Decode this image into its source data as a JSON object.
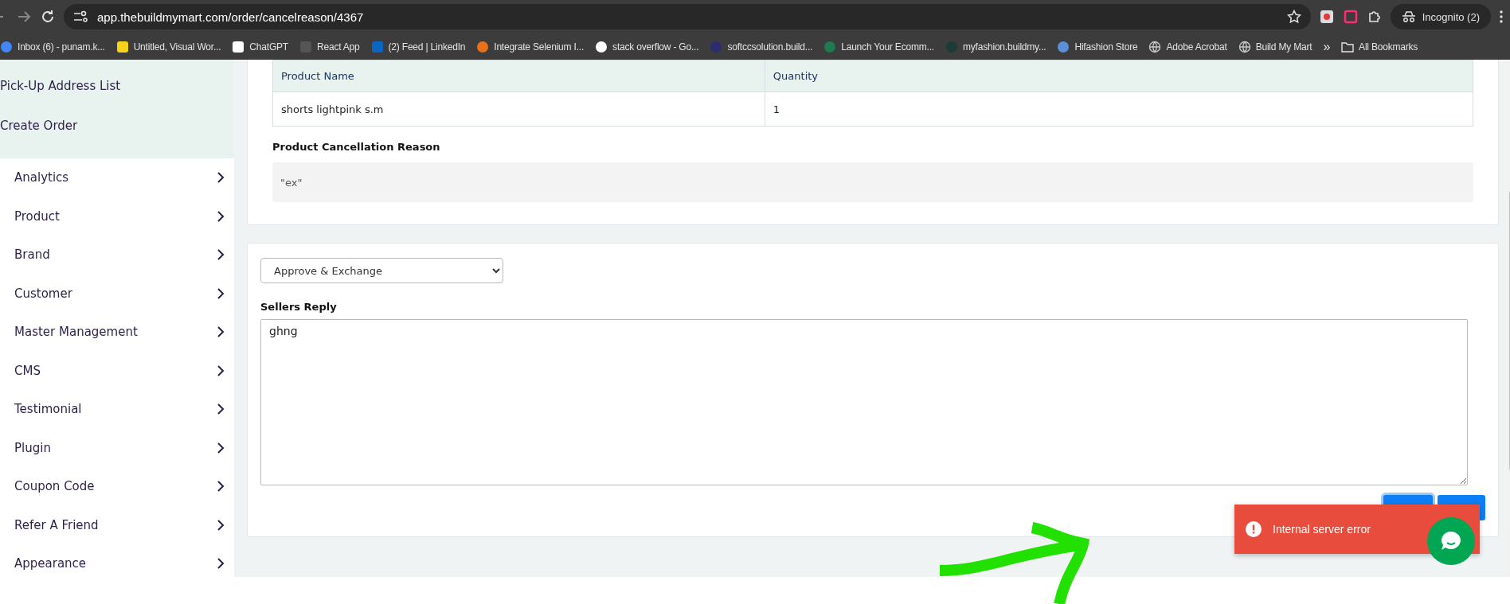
{
  "browser": {
    "url": "app.thebuildmymart.com/order/cancelreason/4367",
    "incognito_label": "Incognito (2)",
    "bookmarks": [
      {
        "label": "Inbox (6) - punam.k...",
        "kind": "circle",
        "color": "#4285f4"
      },
      {
        "label": "Untitled, Visual Wor...",
        "kind": "square",
        "color": "#f7d21a"
      },
      {
        "label": "ChatGPT",
        "kind": "square",
        "color": "#ffffff"
      },
      {
        "label": "React App",
        "kind": "square",
        "color": "#555555"
      },
      {
        "label": "(2) Feed | LinkedIn",
        "kind": "square",
        "color": "#0a66c2"
      },
      {
        "label": "Integrate Selenium I...",
        "kind": "circle",
        "color": "#e8711a"
      },
      {
        "label": "stack overflow - Go...",
        "kind": "circle",
        "color": "#ffffff"
      },
      {
        "label": "softccsolution.build...",
        "kind": "circle",
        "color": "#2b2d6e"
      },
      {
        "label": "Launch Your Ecomm...",
        "kind": "circle",
        "color": "#1e7a4f"
      },
      {
        "label": "myfashion.buildmy...",
        "kind": "circle",
        "color": "#1b3a3a"
      },
      {
        "label": "Hifashion Store",
        "kind": "circle",
        "color": "#5b8fd8"
      },
      {
        "label": "Adobe Acrobat",
        "kind": "globe",
        "color": "#c8c8c8"
      },
      {
        "label": "Build My Mart",
        "kind": "globe",
        "color": "#c8c8c8"
      }
    ],
    "overflow": "»",
    "all_bookmarks": "All Bookmarks"
  },
  "sidebar": {
    "items": [
      {
        "label": "Pick-Up Address List",
        "kind": "subitem"
      },
      {
        "label": "Create Order",
        "kind": "subitem"
      },
      {
        "label": "Analytics",
        "kind": "menu"
      },
      {
        "label": "Product",
        "kind": "menu"
      },
      {
        "label": "Brand",
        "kind": "menu"
      },
      {
        "label": "Customer",
        "kind": "menu"
      },
      {
        "label": "Master Management",
        "kind": "menu"
      },
      {
        "label": "CMS",
        "kind": "menu"
      },
      {
        "label": "Testimonial",
        "kind": "menu"
      },
      {
        "label": "Plugin",
        "kind": "menu"
      },
      {
        "label": "Coupon Code",
        "kind": "menu"
      },
      {
        "label": "Refer A Friend",
        "kind": "menu"
      },
      {
        "label": "Appearance",
        "kind": "menu"
      }
    ]
  },
  "products_table": {
    "columns": [
      "Product Name",
      "Quantity"
    ],
    "rows": [
      [
        "shorts lightpink s.m",
        "1"
      ]
    ]
  },
  "cancellation_reason": {
    "label": "Product Cancellation Reason",
    "value": "\"ex\""
  },
  "reply_form": {
    "action_select": {
      "value": "Approve & Exchange"
    },
    "reply_label": "Sellers Reply",
    "reply_text": "ghng"
  },
  "toast": {
    "message": "Internal server error"
  }
}
